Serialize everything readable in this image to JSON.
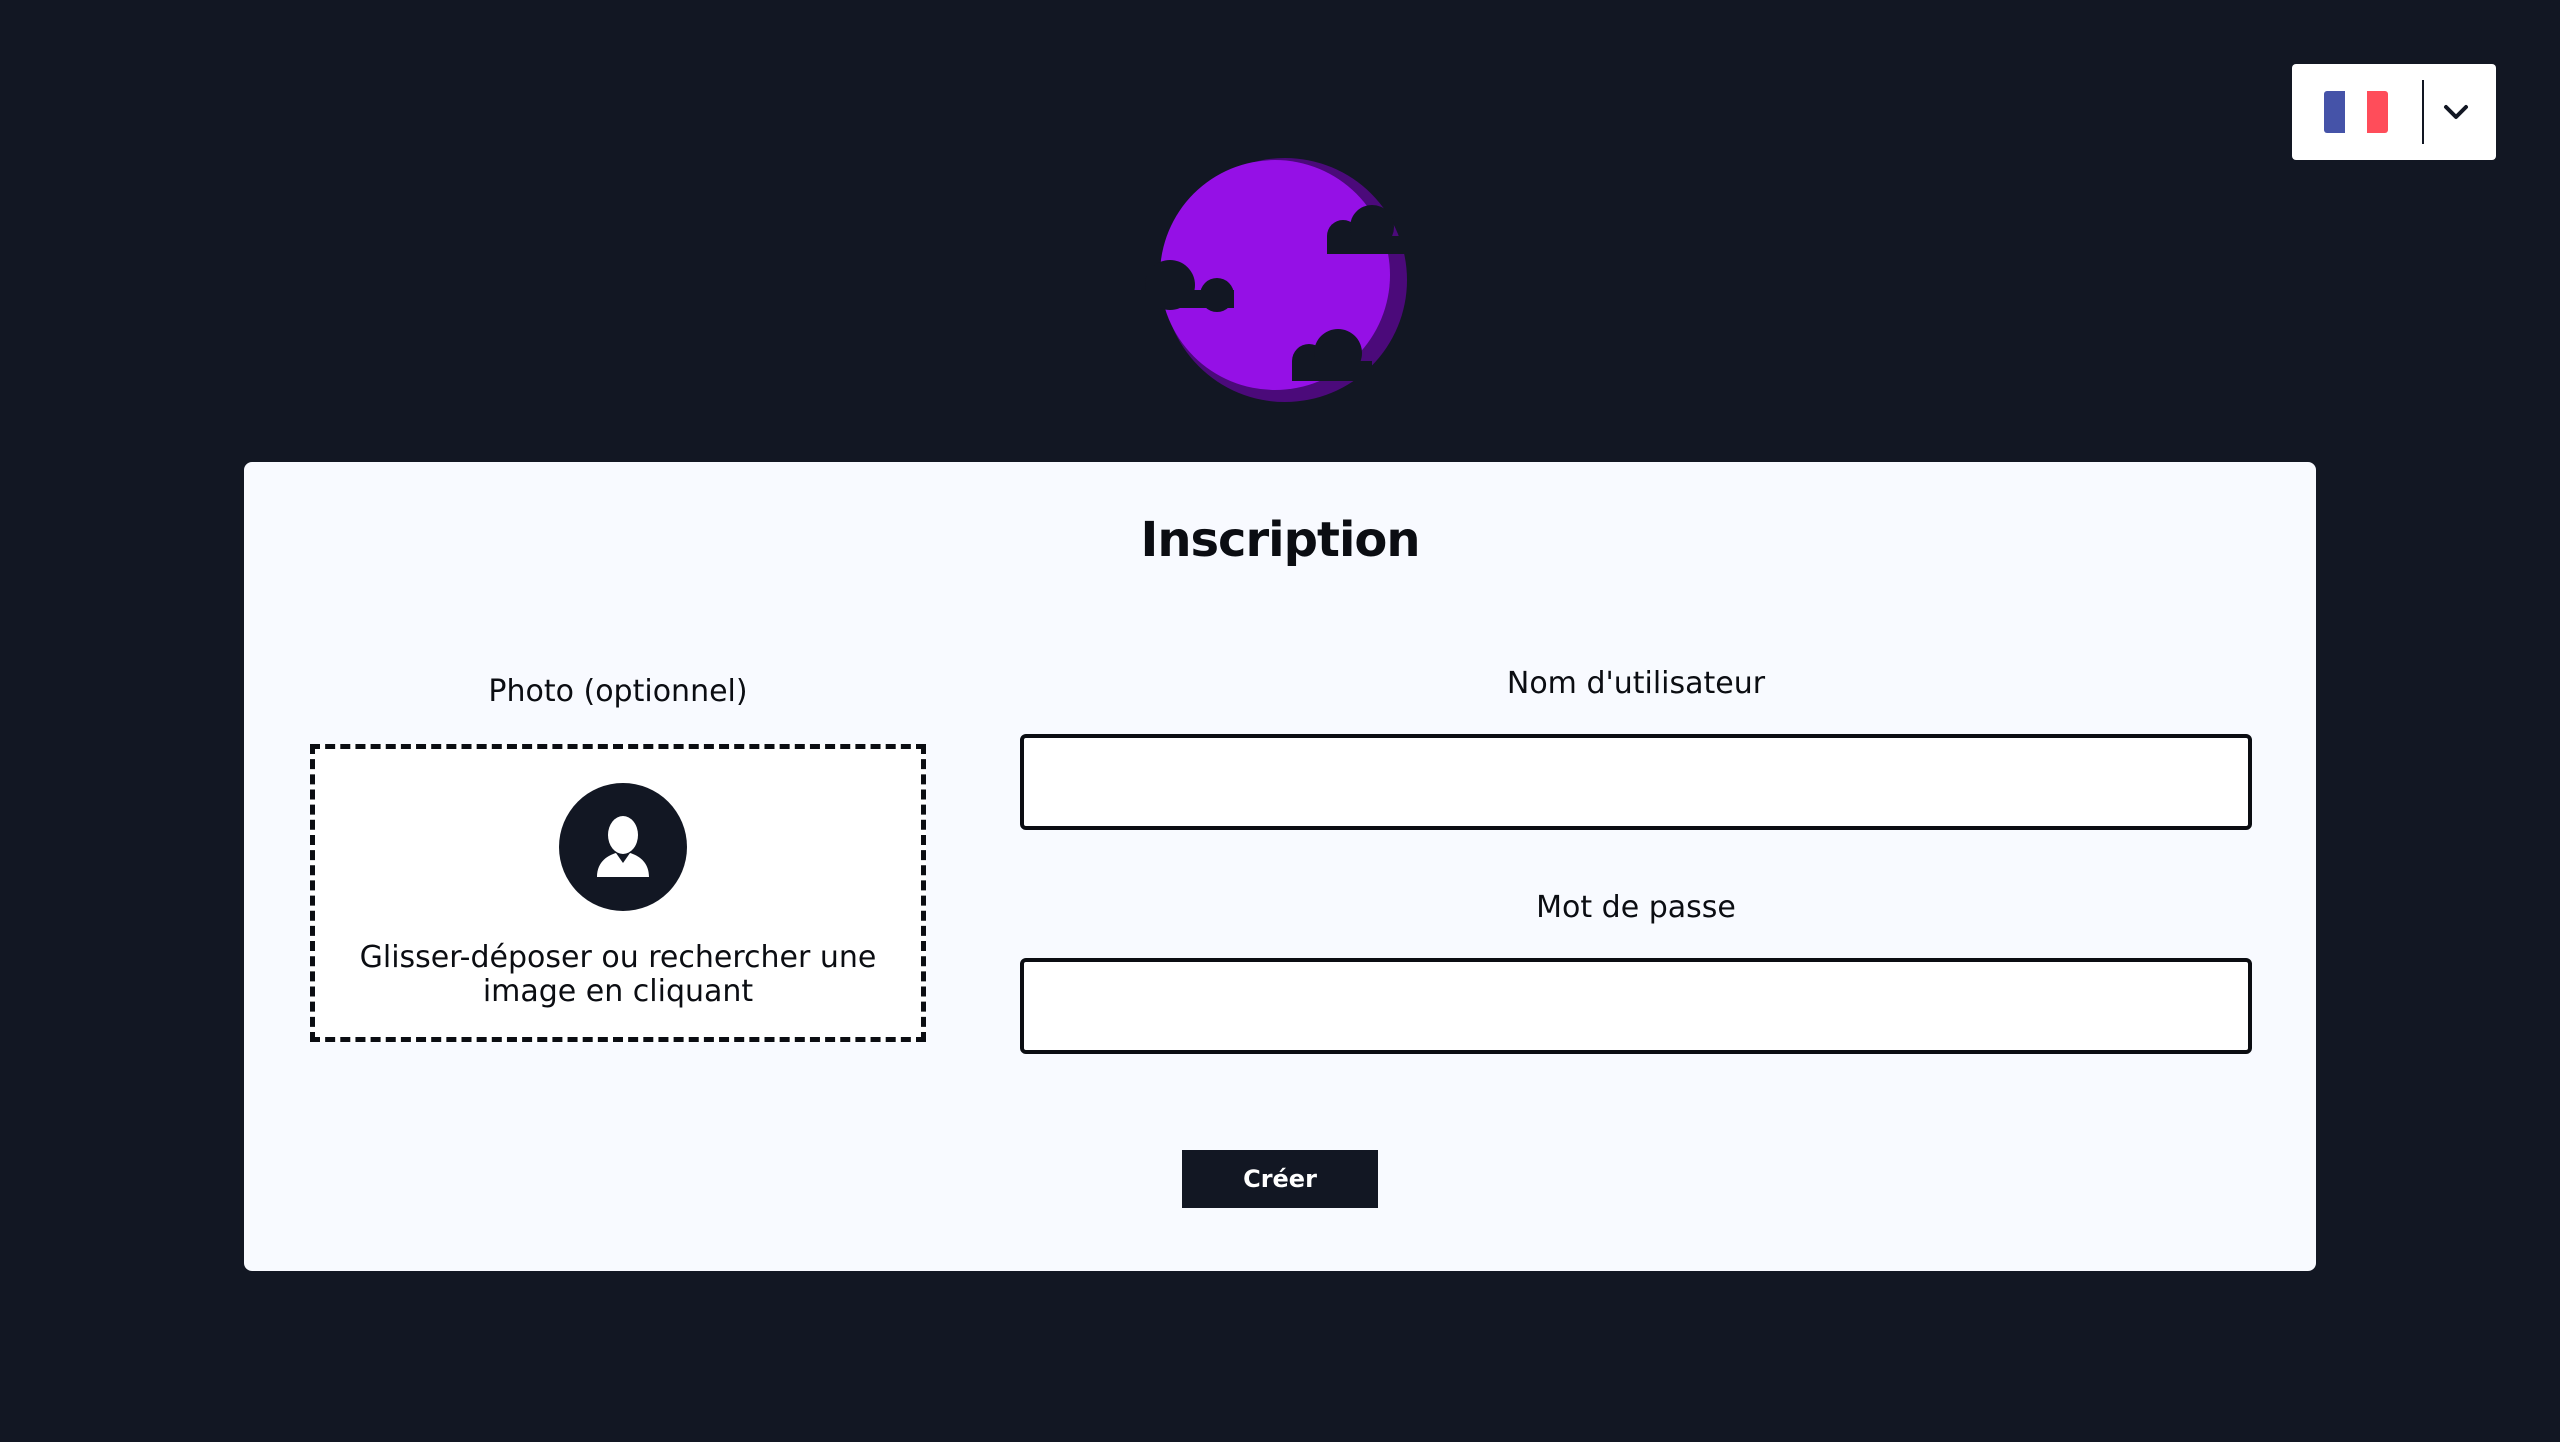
{
  "language_selector": {
    "current_language_icon": "france-flag-icon",
    "flag_colors": [
      "#4553a8",
      "#ffffff",
      "#ff4d5a"
    ],
    "toggle_icon": "chevron-down-icon"
  },
  "logo": {
    "icon": "purple-moon-clouds-logo",
    "colors": {
      "moon": "#9510e6",
      "shadow": "#4b0a7a",
      "clouds": "#121723"
    }
  },
  "form": {
    "title": "Inscription",
    "photo": {
      "label": "Photo (optionnel)",
      "dropzone_icon": "user-avatar-icon",
      "dropzone_text": "Glisser-déposer ou rechercher une image en cliquant"
    },
    "username": {
      "label": "Nom d'utilisateur",
      "value": "",
      "placeholder": ""
    },
    "password": {
      "label": "Mot de passe",
      "value": "",
      "placeholder": ""
    },
    "submit_label": "Créer"
  },
  "colors": {
    "background": "#121723",
    "card": "#f8faff",
    "text": "#0b0d12",
    "button": "#121723"
  }
}
